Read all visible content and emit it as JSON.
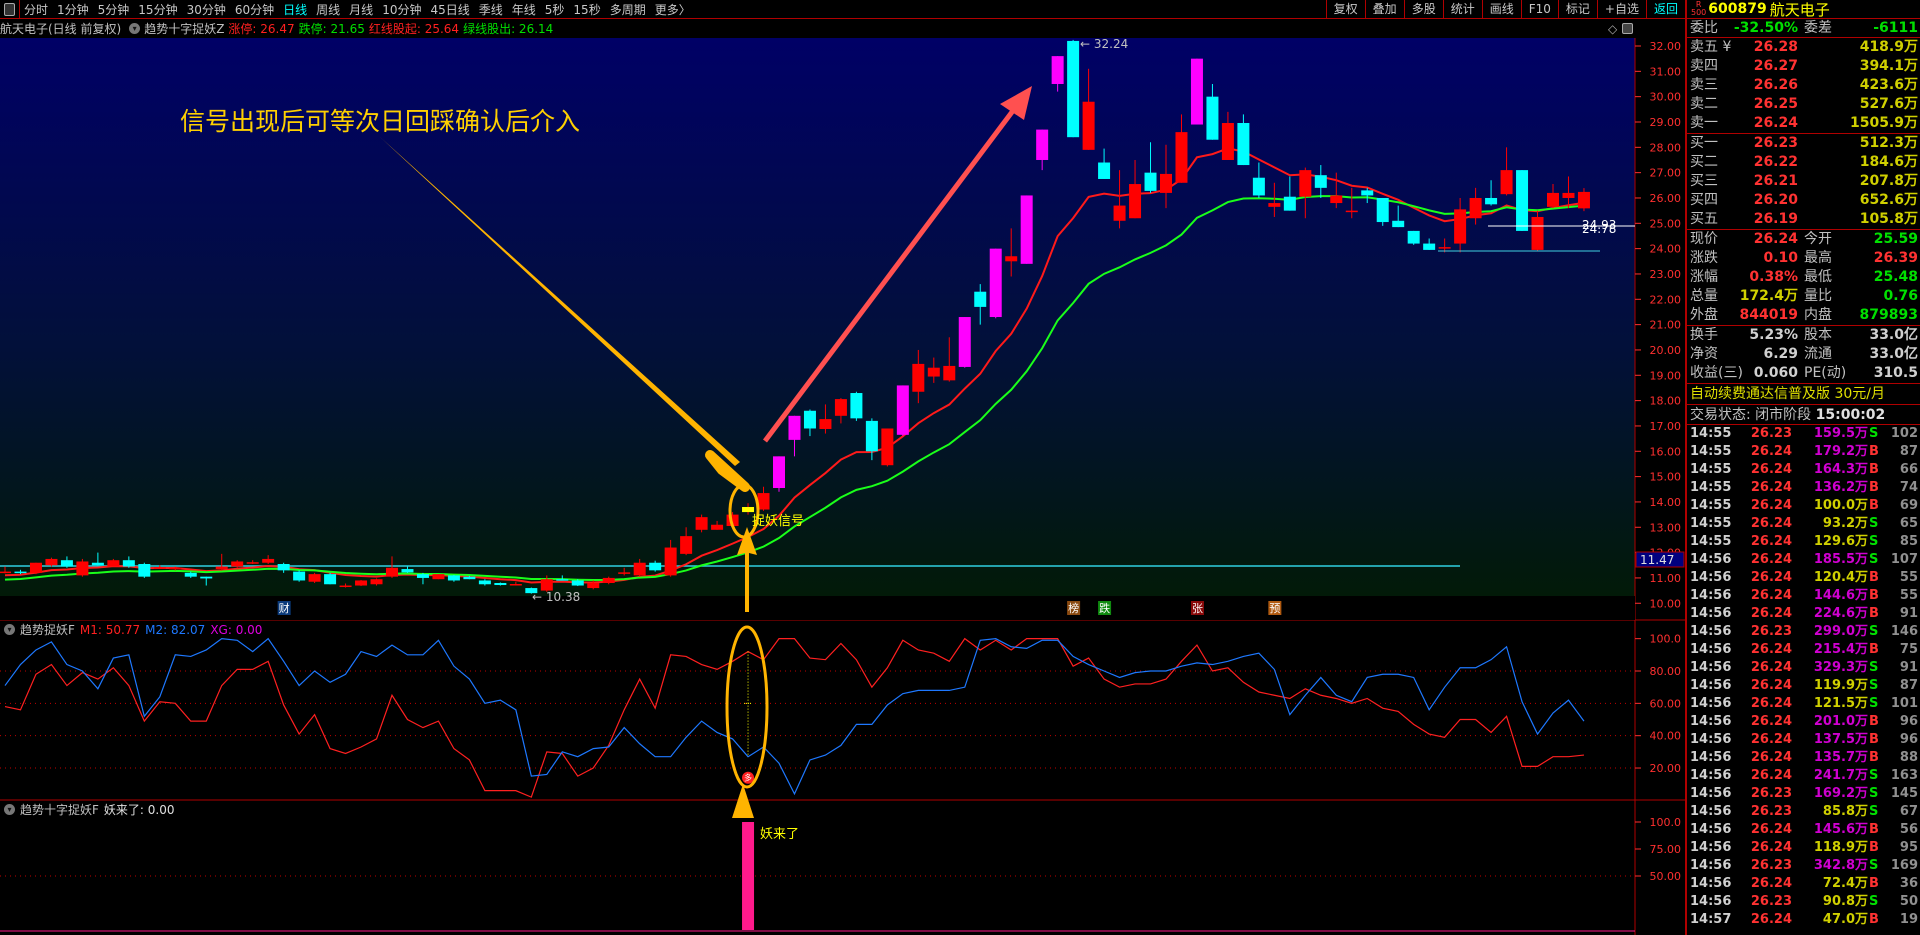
{
  "toolbar": {
    "periods": [
      "分时",
      "1分钟",
      "5分钟",
      "15分钟",
      "30分钟",
      "60分钟",
      "日线",
      "周线",
      "月线",
      "10分钟",
      "45日线",
      "季线",
      "年线",
      "5秒",
      "15秒",
      "多周期",
      "更多〉"
    ],
    "active_period": "日线",
    "buttons": [
      "复权",
      "叠加",
      "多股",
      "统计",
      "画线",
      "F10",
      "标记",
      "+自选",
      "返回"
    ]
  },
  "titlebar": {
    "stock": "航天电子(日线 前复权)",
    "indicator": "趋势十字捉妖Z",
    "items": [
      {
        "label": "涨停: 26.47",
        "color": "#ff2020"
      },
      {
        "label": "跌停: 21.65",
        "color": "#00e000"
      },
      {
        "label": "红线股起: 25.64",
        "color": "#ff2020"
      },
      {
        "label": "绿线股出: 26.14",
        "color": "#00e000"
      }
    ]
  },
  "indicator1": {
    "name": "趋势捉妖F",
    "m1": "M1: 50.77",
    "m2": "M2: 82.07",
    "xg": "XG: 0.00",
    "axis": [
      "100.0",
      "80.00",
      "60.00",
      "40.00",
      "20.00"
    ],
    "badge": "多"
  },
  "indicator2": {
    "name": "趋势十字捉妖F",
    "value": "妖来了: 0.00",
    "axis": [
      "100.0",
      "75.00",
      "50.00"
    ],
    "bar_label": "妖来了"
  },
  "annotations": {
    "headline": "信号出现后可等次日回踩确认后介入",
    "signal_label": "捉妖信号",
    "high_label": "32.24",
    "low_label": "10.38",
    "right_label_1": "24.93",
    "right_label_2": "24.78",
    "price_marker": "11.47"
  },
  "markers": [
    {
      "text": "财",
      "index": 18,
      "bg": "#0a3a7a"
    },
    {
      "text": "榜",
      "index": 69,
      "bg": "#8a4a10"
    },
    {
      "text": "跌",
      "index": 71,
      "bg": "#108a10"
    },
    {
      "text": "张",
      "index": 77,
      "bg": "#8a0a0a"
    },
    {
      "text": "预",
      "index": 82,
      "bg": "#b05a10"
    }
  ],
  "colors": {
    "up": "#ff0000",
    "down": "#00ffff",
    "highlight": "#ff00ff",
    "signal": "#ffff00",
    "ma_fast": "#ff1a1a",
    "ma_slow": "#1aff1a",
    "m1": "#ff2020",
    "m2": "#1e78ff",
    "accent": "#ffb400"
  },
  "chart_data": {
    "type": "candlestick",
    "price_axis": [
      "32.00",
      "31.00",
      "30.00",
      "29.00",
      "28.00",
      "27.00",
      "26.00",
      "25.00",
      "24.00",
      "23.00",
      "22.00",
      "21.00",
      "20.00",
      "19.00",
      "18.00",
      "17.00",
      "16.00",
      "15.00",
      "14.00",
      "13.00",
      "12.00",
      "11.00",
      "10.00"
    ],
    "ylim": [
      10,
      32
    ],
    "signal_index": 48,
    "highlight_indices": [
      50,
      51,
      58,
      62,
      64,
      66,
      67,
      68,
      77
    ],
    "ohlc": [
      [
        11.2,
        11.45,
        11.18,
        11.25
      ],
      [
        11.25,
        11.32,
        11.15,
        11.2
      ],
      [
        11.2,
        11.6,
        11.15,
        11.6
      ],
      [
        11.5,
        11.8,
        11.45,
        11.75
      ],
      [
        11.7,
        11.85,
        11.4,
        11.45
      ],
      [
        11.1,
        11.75,
        11.05,
        11.65
      ],
      [
        11.6,
        12.0,
        11.5,
        11.5
      ],
      [
        11.45,
        11.75,
        11.45,
        11.7
      ],
      [
        11.7,
        11.85,
        11.4,
        11.45
      ],
      [
        11.55,
        11.6,
        11.0,
        11.05
      ],
      [
        11.38,
        11.5,
        11.35,
        11.42
      ],
      [
        11.35,
        11.45,
        11.3,
        11.4
      ],
      [
        11.2,
        11.25,
        11.0,
        11.05
      ],
      [
        11.05,
        11.05,
        10.7,
        10.98
      ],
      [
        11.35,
        11.95,
        11.3,
        11.45
      ],
      [
        11.45,
        11.7,
        11.4,
        11.65
      ],
      [
        11.6,
        11.7,
        11.55,
        11.62
      ],
      [
        11.6,
        11.9,
        11.55,
        11.75
      ],
      [
        11.55,
        11.6,
        11.2,
        11.3
      ],
      [
        11.25,
        11.3,
        10.85,
        10.9
      ],
      [
        10.85,
        11.2,
        10.8,
        11.15
      ],
      [
        11.15,
        11.2,
        10.75,
        10.75
      ],
      [
        10.68,
        10.78,
        10.62,
        10.7
      ],
      [
        10.7,
        10.92,
        10.68,
        10.9
      ],
      [
        10.75,
        10.98,
        10.7,
        10.95
      ],
      [
        11.05,
        11.85,
        11.0,
        11.4
      ],
      [
        11.35,
        11.45,
        11.2,
        11.22
      ],
      [
        11.15,
        11.2,
        10.75,
        11.0
      ],
      [
        10.95,
        11.15,
        10.95,
        11.15
      ],
      [
        11.1,
        11.12,
        10.85,
        10.9
      ],
      [
        11.05,
        11.08,
        10.95,
        10.95
      ],
      [
        10.9,
        10.95,
        10.7,
        10.75
      ],
      [
        10.8,
        10.82,
        10.7,
        10.72
      ],
      [
        10.75,
        10.85,
        10.7,
        10.76
      ],
      [
        10.6,
        10.62,
        10.38,
        10.4
      ],
      [
        10.5,
        11.1,
        10.45,
        10.95
      ],
      [
        10.95,
        11.1,
        10.9,
        10.9
      ],
      [
        10.9,
        10.95,
        10.68,
        10.7
      ],
      [
        10.6,
        10.9,
        10.55,
        10.8
      ],
      [
        10.8,
        11.05,
        10.75,
        11.0
      ],
      [
        11.2,
        11.4,
        11.1,
        11.22
      ],
      [
        11.1,
        11.75,
        11.05,
        11.6
      ],
      [
        11.6,
        11.68,
        11.25,
        11.3
      ],
      [
        11.1,
        12.5,
        11.05,
        12.2
      ],
      [
        11.95,
        13.0,
        11.9,
        12.65
      ],
      [
        12.9,
        13.5,
        12.8,
        13.4
      ],
      [
        12.9,
        13.25,
        12.9,
        13.1
      ],
      [
        13.05,
        13.6,
        13.0,
        13.5
      ],
      [
        13.6,
        13.95,
        13.5,
        13.8
      ],
      [
        13.7,
        14.6,
        13.65,
        14.35
      ],
      [
        14.55,
        15.8,
        14.4,
        15.8
      ],
      [
        16.45,
        17.4,
        15.8,
        17.4
      ],
      [
        17.6,
        17.65,
        16.6,
        16.9
      ],
      [
        16.88,
        17.85,
        16.7,
        17.27
      ],
      [
        17.4,
        18.1,
        17.1,
        18.06
      ],
      [
        18.3,
        18.35,
        17.2,
        17.3
      ],
      [
        17.2,
        17.3,
        15.65,
        16.0
      ],
      [
        15.45,
        16.9,
        15.4,
        16.9
      ],
      [
        16.65,
        18.6,
        16.6,
        18.6
      ],
      [
        18.35,
        20.0,
        17.9,
        19.45
      ],
      [
        18.95,
        19.7,
        18.7,
        19.3
      ],
      [
        18.8,
        20.5,
        18.75,
        19.37
      ],
      [
        19.33,
        21.3,
        19.3,
        21.3
      ],
      [
        22.3,
        22.6,
        21.0,
        21.7
      ],
      [
        21.3,
        24.0,
        21.25,
        24.0
      ],
      [
        23.5,
        24.8,
        22.9,
        23.7
      ],
      [
        23.4,
        26.1,
        23.4,
        26.1
      ],
      [
        27.5,
        28.7,
        27.1,
        28.7
      ],
      [
        30.5,
        31.6,
        30.2,
        31.6
      ],
      [
        32.2,
        32.24,
        28.4,
        28.4
      ],
      [
        27.9,
        31.1,
        27.9,
        29.8
      ],
      [
        27.4,
        27.95,
        26.75,
        26.75
      ],
      [
        25.1,
        27.1,
        24.8,
        25.7
      ],
      [
        25.2,
        27.5,
        25.2,
        26.55
      ],
      [
        27.0,
        28.2,
        26.2,
        26.28
      ],
      [
        26.2,
        28.1,
        25.6,
        26.95
      ],
      [
        26.6,
        29.3,
        26.6,
        28.6
      ],
      [
        28.9,
        31.5,
        28.9,
        31.5
      ],
      [
        30.0,
        30.5,
        28.3,
        28.3
      ],
      [
        27.5,
        29.4,
        27.5,
        28.96
      ],
      [
        28.96,
        29.3,
        27.3,
        27.3
      ],
      [
        26.8,
        27.4,
        26.0,
        26.1
      ],
      [
        25.65,
        26.6,
        25.25,
        25.8
      ],
      [
        26.05,
        26.85,
        25.5,
        25.5
      ],
      [
        26.05,
        27.2,
        25.2,
        27.1
      ],
      [
        26.9,
        27.3,
        26.0,
        26.4
      ],
      [
        25.8,
        27.0,
        25.6,
        26.1
      ],
      [
        25.45,
        26.4,
        25.2,
        25.5
      ],
      [
        26.3,
        26.4,
        25.8,
        26.1
      ],
      [
        26.0,
        26.0,
        24.9,
        25.05
      ],
      [
        25.1,
        25.7,
        24.85,
        24.85
      ],
      [
        24.7,
        24.7,
        24.15,
        24.2
      ],
      [
        24.2,
        24.4,
        23.95,
        23.95
      ],
      [
        24.02,
        24.4,
        23.85,
        24.06
      ],
      [
        24.2,
        26.0,
        23.85,
        25.55
      ],
      [
        25.2,
        26.4,
        24.95,
        26.0
      ],
      [
        26.0,
        26.7,
        25.7,
        25.75
      ],
      [
        26.15,
        28.0,
        26.1,
        27.1
      ],
      [
        27.1,
        27.1,
        24.7,
        24.7
      ],
      [
        23.95,
        25.5,
        23.9,
        25.25
      ],
      [
        25.65,
        26.55,
        25.6,
        26.2
      ],
      [
        26.0,
        26.85,
        25.6,
        26.2
      ],
      [
        25.59,
        26.39,
        25.48,
        26.24
      ]
    ],
    "m1": [
      58,
      56,
      78,
      84,
      71,
      79,
      75,
      82,
      71,
      49,
      61,
      60,
      49,
      49,
      71,
      81,
      81,
      86,
      59,
      41,
      53,
      32,
      29,
      33,
      38,
      65,
      50,
      45,
      49,
      32,
      25,
      6,
      6,
      6,
      2,
      30,
      29,
      15,
      20,
      34,
      56,
      75,
      57,
      90,
      89,
      84,
      81,
      86,
      92,
      87,
      100,
      100,
      88,
      87,
      97,
      87,
      70,
      82,
      99,
      93,
      91,
      86,
      100,
      93,
      99,
      93,
      100,
      100,
      100,
      83,
      88,
      75,
      70,
      72,
      72,
      75,
      86,
      96,
      80,
      82,
      73,
      67,
      65,
      63,
      69,
      65,
      63,
      60,
      63,
      57,
      55,
      47,
      41,
      39,
      50,
      50,
      42,
      52,
      21,
      21,
      27,
      27,
      28
    ],
    "m2": [
      71,
      84,
      93,
      98,
      84,
      80,
      69,
      88,
      90,
      52,
      64,
      90,
      89,
      93,
      100,
      99,
      92,
      100,
      86,
      71,
      80,
      73,
      78,
      92,
      89,
      96,
      90,
      90,
      99,
      83,
      75,
      60,
      62,
      56,
      15,
      16,
      30,
      27,
      32,
      33,
      45,
      35,
      27,
      27,
      39,
      49,
      42,
      38,
      27,
      33,
      23,
      4,
      25,
      28,
      34,
      47,
      47,
      59,
      66,
      68,
      68,
      68,
      70,
      99,
      100,
      95,
      94,
      99,
      99,
      89,
      84,
      80,
      76,
      79,
      80,
      80,
      83,
      85,
      84,
      86,
      89,
      91,
      81,
      53,
      65,
      76,
      65,
      61,
      76,
      78,
      78,
      76,
      56,
      70,
      82,
      82,
      87,
      95,
      61,
      41,
      54,
      62,
      49
    ],
    "m_axis_ylim": [
      0,
      100
    ],
    "yaolai": {
      "index": 48,
      "value": 100
    }
  },
  "panel": {
    "code": "600879",
    "name": "航天电子",
    "r_badge": "R",
    "r_num": "500",
    "wb": {
      "l1": "委比",
      "v1": "-32.50%",
      "l2": "委差",
      "v2": "-6111"
    },
    "asks": [
      [
        "卖五 ¥",
        "26.28",
        "418.9万"
      ],
      [
        "卖四",
        "26.27",
        "394.1万"
      ],
      [
        "卖三",
        "26.26",
        "423.6万"
      ],
      [
        "卖二",
        "26.25",
        "527.6万"
      ],
      [
        "卖一",
        "26.24",
        "1505.9万"
      ]
    ],
    "bids": [
      [
        "买一",
        "26.23",
        "512.3万"
      ],
      [
        "买二",
        "26.22",
        "184.6万"
      ],
      [
        "买三",
        "26.21",
        "207.8万"
      ],
      [
        "买四",
        "26.20",
        "652.6万"
      ],
      [
        "买五",
        "26.19",
        "105.8万"
      ]
    ],
    "quote": [
      {
        "l1": "现价",
        "v1": "26.24",
        "c1": "#ff3232",
        "l2": "今开",
        "v2": "25.59",
        "c2": "#00e000"
      },
      {
        "l1": "涨跌",
        "v1": "0.10",
        "c1": "#ff3232",
        "l2": "最高",
        "v2": "26.39",
        "c2": "#ff3232"
      },
      {
        "l1": "涨幅",
        "v1": "0.38%",
        "c1": "#ff3232",
        "l2": "最低",
        "v2": "25.48",
        "c2": "#00e000"
      },
      {
        "l1": "总量",
        "v1": "172.4万",
        "c1": "#d0d000",
        "l2": "量比",
        "v2": "0.76",
        "c2": "#00e000"
      },
      {
        "l1": "外盘",
        "v1": "844019",
        "c1": "#ff3232",
        "l2": "内盘",
        "v2": "879893",
        "c2": "#00e000"
      }
    ],
    "fin": [
      {
        "l1": "换手",
        "v1": "5.23%",
        "l2": "股本",
        "v2": "33.0亿"
      },
      {
        "l1": "净资",
        "v1": "6.29",
        "l2": "流通",
        "v2": "33.0亿"
      },
      {
        "l1": "收益(三)",
        "v1": "0.060",
        "l2": "PE(动)",
        "v2": "310.5"
      }
    ],
    "ad": "自动续费通达信普及版  30元/月",
    "status_label": "交易状态: 闭市阶段",
    "status_time": "15:00:02",
    "ticks": [
      [
        "14:55",
        "26.23",
        "159.5万",
        "S",
        "102"
      ],
      [
        "14:55",
        "26.24",
        "179.2万",
        "B",
        "87"
      ],
      [
        "14:55",
        "26.24",
        "164.3万",
        "B",
        "66"
      ],
      [
        "14:55",
        "26.24",
        "136.2万",
        "B",
        "74"
      ],
      [
        "14:55",
        "26.24",
        "100.0万",
        "B",
        "69"
      ],
      [
        "14:55",
        "26.24",
        "93.2万",
        "S",
        "65"
      ],
      [
        "14:55",
        "26.24",
        "129.6万",
        "S",
        "85"
      ],
      [
        "14:56",
        "26.24",
        "185.5万",
        "S",
        "107"
      ],
      [
        "14:56",
        "26.24",
        "120.4万",
        "B",
        "55"
      ],
      [
        "14:56",
        "26.24",
        "144.6万",
        "B",
        "55"
      ],
      [
        "14:56",
        "26.24",
        "224.6万",
        "B",
        "91"
      ],
      [
        "14:56",
        "26.23",
        "299.0万",
        "S",
        "146"
      ],
      [
        "14:56",
        "26.24",
        "215.4万",
        "B",
        "75"
      ],
      [
        "14:56",
        "26.24",
        "329.3万",
        "S",
        "91"
      ],
      [
        "14:56",
        "26.24",
        "119.9万",
        "S",
        "87"
      ],
      [
        "14:56",
        "26.24",
        "121.5万",
        "S",
        "101"
      ],
      [
        "14:56",
        "26.24",
        "201.0万",
        "B",
        "96"
      ],
      [
        "14:56",
        "26.24",
        "137.5万",
        "B",
        "96"
      ],
      [
        "14:56",
        "26.24",
        "135.7万",
        "B",
        "88"
      ],
      [
        "14:56",
        "26.24",
        "241.7万",
        "S",
        "163"
      ],
      [
        "14:56",
        "26.23",
        "169.2万",
        "S",
        "145"
      ],
      [
        "14:56",
        "26.23",
        "85.8万",
        "S",
        "67"
      ],
      [
        "14:56",
        "26.24",
        "145.6万",
        "B",
        "56"
      ],
      [
        "14:56",
        "26.24",
        "118.9万",
        "B",
        "95"
      ],
      [
        "14:56",
        "26.23",
        "342.8万",
        "S",
        "169"
      ],
      [
        "14:56",
        "26.24",
        "72.4万",
        "B",
        "36"
      ],
      [
        "14:56",
        "26.23",
        "90.8万",
        "S",
        "50"
      ],
      [
        "14:57",
        "26.24",
        "47.0万",
        "B",
        "19"
      ]
    ]
  }
}
